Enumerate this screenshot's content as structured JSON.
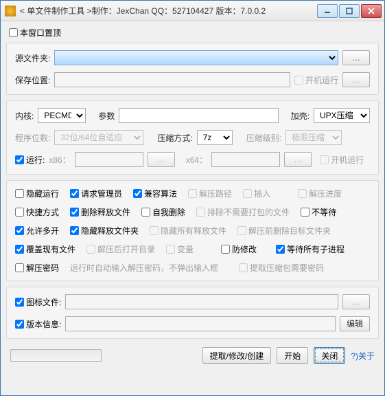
{
  "title": "< 单文件制作工具 >制作：JexChan   QQ：527104427   版本：7.0.0.2",
  "pin_top": "本窗口置顶",
  "src": {
    "label": "源文件夹:",
    "value": "",
    "browse": "…"
  },
  "save": {
    "label": "保存位置:",
    "value": "",
    "startup": "开机运行",
    "browse": "…"
  },
  "kernel": {
    "label": "内核:",
    "value": "PECMD"
  },
  "params": {
    "label": "参数",
    "value": ""
  },
  "shell": {
    "label": "加壳:",
    "value": "UPX压缩"
  },
  "bits": {
    "label": "程序位数:",
    "value": "32位/64位自适应"
  },
  "cmethod": {
    "label": "压缩方式:",
    "value": "7z"
  },
  "clevel": {
    "label": "压缩级别:",
    "value": "极限压缩"
  },
  "run": {
    "label": "运行:",
    "x86": "x86：",
    "x64": "x64：",
    "browse": "…",
    "startup": "开机运行"
  },
  "opts": {
    "hide_run": "隐藏运行",
    "req_admin": "请求管理员",
    "compat": "兼容算法",
    "depath": "解压路径",
    "insert": "插入",
    "deprog": "解压进度",
    "shortcut": "快捷方式",
    "del_rel": "删除释放文件",
    "self_del": "自我删除",
    "exclude": "排除不需要打包的文件",
    "nowait": "不等待",
    "multi": "允许多开",
    "hide_reldir": "隐藏释放文件夹",
    "hide_all_rel": "隐藏所有释放文件",
    "del_before": "解压前删除目标文件夹",
    "overwrite": "覆盖现有文件",
    "open_after": "解压后打开目录",
    "var": "变量",
    "antimod": "防修改",
    "wait_child": "等待所有子进程",
    "pwd": "解压密码",
    "note_pwd": "运行时自动输入解压密码，不弹出输入框",
    "pick_pwd": "提取压缩包需要密码"
  },
  "checks": {
    "req_admin": true,
    "compat": true,
    "del_rel": true,
    "multi": true,
    "hide_reldir": true,
    "overwrite": true,
    "wait_child": true,
    "run": true,
    "icon": true,
    "ver": true
  },
  "icon": {
    "label": "图标文件:",
    "browse": "…"
  },
  "ver": {
    "label": "版本信息:",
    "edit": "编辑"
  },
  "bottom": {
    "extract": "提取/修改/创建",
    "start": "开始",
    "close": "关闭",
    "about": "?)关于"
  }
}
